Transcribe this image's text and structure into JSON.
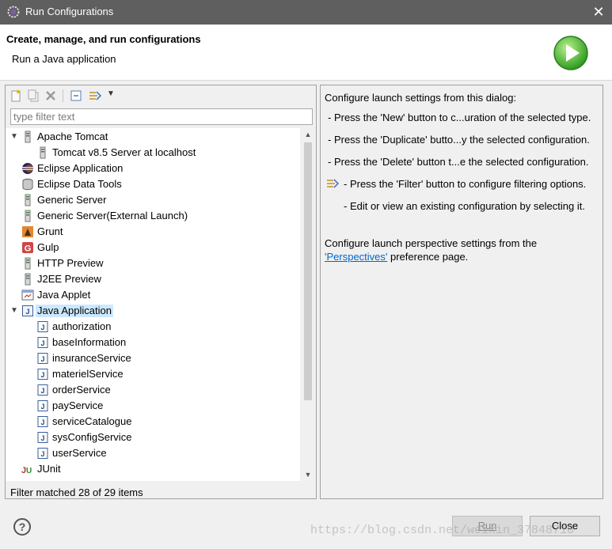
{
  "window": {
    "title": "Run Configurations",
    "close_glyph": "✕"
  },
  "header": {
    "title": "Create, manage, and run configurations",
    "subtitle": "Run a Java application"
  },
  "left": {
    "filter_placeholder": "type filter text",
    "status": "Filter matched 28 of 29 items",
    "tree": [
      {
        "label": "Apache Tomcat",
        "icon": "server-icon",
        "level": 0,
        "twisty": "▼"
      },
      {
        "label": "Tomcat v8.5 Server at localhost",
        "icon": "server-icon",
        "level": 1,
        "twisty": ""
      },
      {
        "label": "Eclipse Application",
        "icon": "eclipse-icon",
        "level": 0,
        "twisty": ""
      },
      {
        "label": "Eclipse Data Tools",
        "icon": "database-icon",
        "level": 0,
        "twisty": ""
      },
      {
        "label": "Generic Server",
        "icon": "server-icon",
        "level": 0,
        "twisty": ""
      },
      {
        "label": "Generic Server(External Launch)",
        "icon": "server-icon",
        "level": 0,
        "twisty": ""
      },
      {
        "label": "Grunt",
        "icon": "grunt-icon",
        "level": 0,
        "twisty": ""
      },
      {
        "label": "Gulp",
        "icon": "gulp-icon",
        "level": 0,
        "twisty": ""
      },
      {
        "label": "HTTP Preview",
        "icon": "server-icon",
        "level": 0,
        "twisty": ""
      },
      {
        "label": "J2EE Preview",
        "icon": "server-icon",
        "level": 0,
        "twisty": ""
      },
      {
        "label": "Java Applet",
        "icon": "applet-icon",
        "level": 0,
        "twisty": ""
      },
      {
        "label": "Java Application",
        "icon": "java-app-icon",
        "level": 0,
        "twisty": "▼",
        "selected": true
      },
      {
        "label": "authorization",
        "icon": "java-file-icon",
        "level": 1,
        "twisty": ""
      },
      {
        "label": "baseInformation",
        "icon": "java-file-icon",
        "level": 1,
        "twisty": ""
      },
      {
        "label": "insuranceService",
        "icon": "java-file-icon",
        "level": 1,
        "twisty": ""
      },
      {
        "label": "materielService",
        "icon": "java-file-icon",
        "level": 1,
        "twisty": ""
      },
      {
        "label": "orderService",
        "icon": "java-file-icon",
        "level": 1,
        "twisty": ""
      },
      {
        "label": "payService",
        "icon": "java-file-icon",
        "level": 1,
        "twisty": ""
      },
      {
        "label": "serviceCatalogue",
        "icon": "java-file-icon",
        "level": 1,
        "twisty": ""
      },
      {
        "label": "sysConfigService",
        "icon": "java-file-icon",
        "level": 1,
        "twisty": ""
      },
      {
        "label": "userService",
        "icon": "java-file-icon",
        "level": 1,
        "twisty": ""
      },
      {
        "label": "JUnit",
        "icon": "junit-icon",
        "level": 0,
        "twisty": ""
      }
    ]
  },
  "right": {
    "intro": "Configure launch settings from this dialog:",
    "items": [
      "- Press the 'New' button to c...uration of the selected type.",
      "- Press the 'Duplicate' butto...y the selected configuration.",
      "- Press the 'Delete' button t...e the selected configuration.",
      "- Press the 'Filter' button to configure filtering options.",
      "- Edit or view an existing configuration by selecting it."
    ],
    "perspective_line": "Configure launch perspective settings from the",
    "perspectives_link": "'Perspectives'",
    "perspective_tail": " preference page."
  },
  "footer": {
    "help_glyph": "?",
    "run_label": "Run",
    "close_label": "Close",
    "watermark": "https://blog.csdn.net/weixin_37848710"
  },
  "colors": {
    "titlebar": "#5f5f5f",
    "selection": "#cce8ff",
    "link": "#0066cc"
  }
}
